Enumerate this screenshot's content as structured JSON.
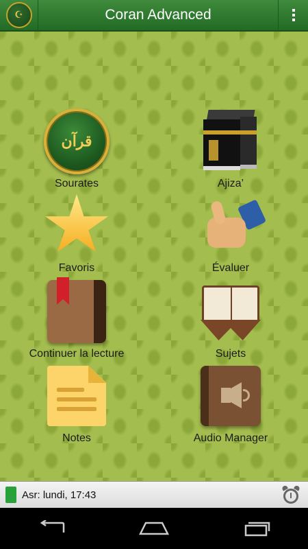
{
  "header": {
    "title": "Coran Advanced",
    "logo_icon": "quran-medallion-icon",
    "menu_icon": "overflow-menu-icon"
  },
  "tiles": [
    {
      "label": "Sourates",
      "icon": "quran-medallion-icon"
    },
    {
      "label": "Ajiza’",
      "icon": "kaaba-icon"
    },
    {
      "label": "Favoris",
      "icon": "star-icon"
    },
    {
      "label": "Évaluer",
      "icon": "thumbs-up-icon"
    },
    {
      "label": "Continuer la lecture",
      "icon": "bookmark-book-icon"
    },
    {
      "label": "Sujets",
      "icon": "open-book-icon"
    },
    {
      "label": "Notes",
      "icon": "note-icon"
    },
    {
      "label": "Audio Manager",
      "icon": "audio-book-icon"
    }
  ],
  "status": {
    "prayer_text": "Asr: lundi, 17:43",
    "indicator_color": "#27a23a",
    "alarm_icon": "alarm-clock-icon"
  },
  "colors": {
    "actionbar": "#2f7a2f",
    "background": "#a4bd4f",
    "title_text": "#ffffff"
  }
}
